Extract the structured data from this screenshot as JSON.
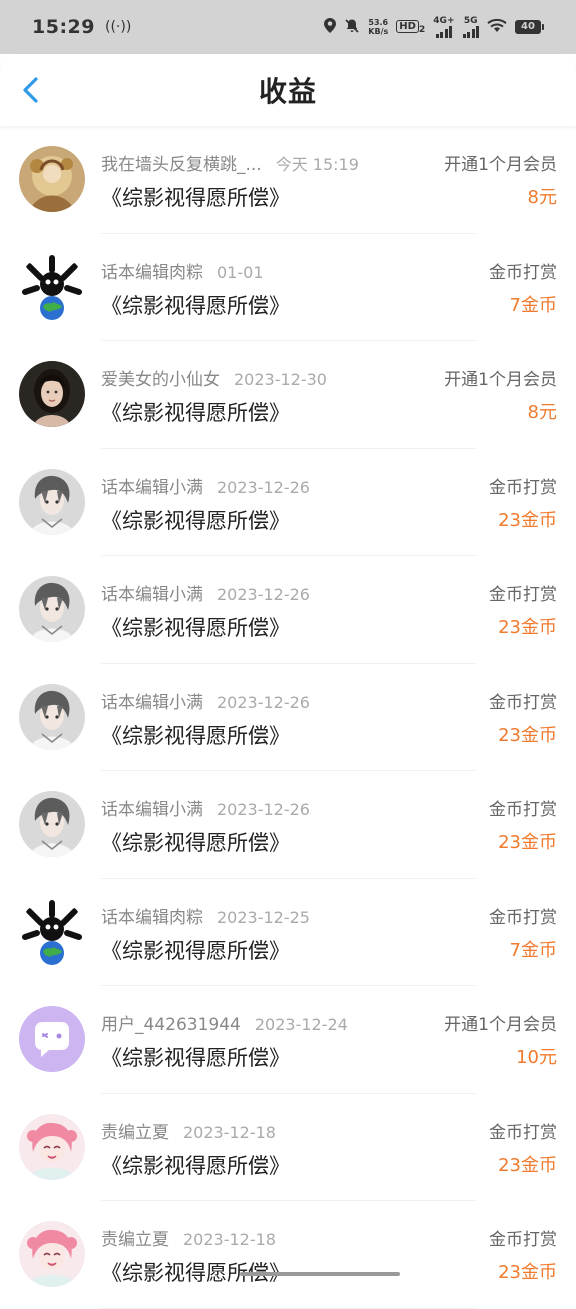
{
  "status_bar": {
    "time": "15:29",
    "speed_value": "53.6",
    "speed_unit": "KB/s",
    "hd": "HD",
    "hd_sub": "2",
    "net1": "4G+",
    "net2": "5G",
    "battery": "40"
  },
  "header": {
    "title": "收益"
  },
  "rows": [
    {
      "name": "我在墙头反复横跳_...",
      "date": "今天 15:19",
      "book": "《综影视得愿所偿》",
      "type": "开通1个月会员",
      "amount": "8元",
      "avatar": "painting-avatar"
    },
    {
      "name": "话本编辑肉粽",
      "date": "01-01",
      "book": "《综影视得愿所偿》",
      "type": "金币打赏",
      "amount": "7金币",
      "avatar": "panda-earth-avatar"
    },
    {
      "name": "爱美女的小仙女",
      "date": "2023-12-30",
      "book": "《综影视得愿所偿》",
      "type": "开通1个月会员",
      "amount": "8元",
      "avatar": "woman-photo-avatar"
    },
    {
      "name": "话本编辑小满",
      "date": "2023-12-26",
      "book": "《综影视得愿所偿》",
      "type": "金币打赏",
      "amount": "23金币",
      "avatar": "anime-boy-avatar"
    },
    {
      "name": "话本编辑小满",
      "date": "2023-12-26",
      "book": "《综影视得愿所偿》",
      "type": "金币打赏",
      "amount": "23金币",
      "avatar": "anime-boy-avatar"
    },
    {
      "name": "话本编辑小满",
      "date": "2023-12-26",
      "book": "《综影视得愿所偿》",
      "type": "金币打赏",
      "amount": "23金币",
      "avatar": "anime-boy-avatar"
    },
    {
      "name": "话本编辑小满",
      "date": "2023-12-26",
      "book": "《综影视得愿所偿》",
      "type": "金币打赏",
      "amount": "23金币",
      "avatar": "anime-boy-avatar"
    },
    {
      "name": "话本编辑肉粽",
      "date": "2023-12-25",
      "book": "《综影视得愿所偿》",
      "type": "金币打赏",
      "amount": "7金币",
      "avatar": "panda-earth-avatar"
    },
    {
      "name": "用户_442631944",
      "date": "2023-12-24",
      "book": "《综影视得愿所偿》",
      "type": "开通1个月会员",
      "amount": "10元",
      "avatar": "default-chat-avatar"
    },
    {
      "name": "责编立夏",
      "date": "2023-12-18",
      "book": "《综影视得愿所偿》",
      "type": "金币打赏",
      "amount": "23金币",
      "avatar": "anime-pink-girl-avatar"
    },
    {
      "name": "责编立夏",
      "date": "2023-12-18",
      "book": "《综影视得愿所偿》",
      "type": "金币打赏",
      "amount": "23金币",
      "avatar": "anime-pink-girl-avatar"
    }
  ],
  "colors": {
    "accent": "#2f9be8",
    "amount": "#f07b2f"
  }
}
